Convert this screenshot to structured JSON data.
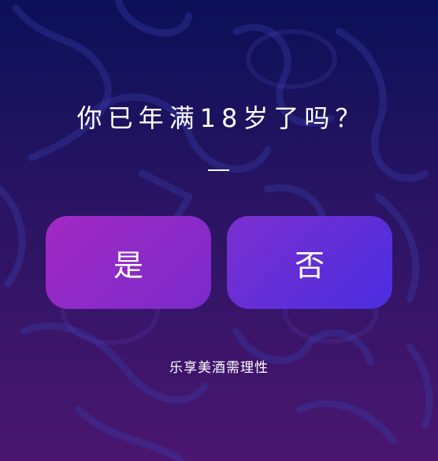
{
  "age_gate": {
    "question": "你已年满18岁了吗？",
    "yes_label": "是",
    "no_label": "否",
    "slogan": "乐享美酒需理性"
  },
  "theme": {
    "background_top": "#0b1058",
    "background_bottom": "#4a1670",
    "yes_button_color": "#a229c3",
    "no_button_color": "#4a2ee0",
    "text_color": "#ffffff"
  }
}
